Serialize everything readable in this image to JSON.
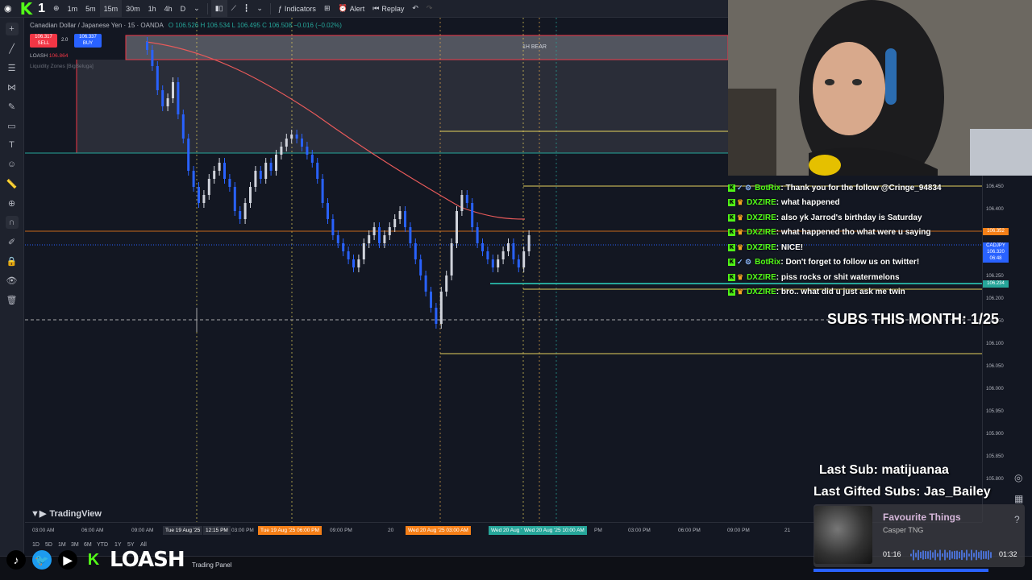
{
  "colors": {
    "up": "#d1d4dc",
    "down": "#2962ff",
    "ema": "#e85a5a",
    "level_yellow": "#e5d25d",
    "level_teal": "#26a69a",
    "bear_zone": "#f23645",
    "kick_green": "#53fc18"
  },
  "topbar": {
    "channel_number": "1",
    "timeframes": [
      "1m",
      "5m",
      "15m",
      "30m",
      "1h",
      "4h",
      "D"
    ],
    "active_timeframe": "15m",
    "indicators_label": "Indicators",
    "alert_label": "Alert",
    "replay_label": "Replay"
  },
  "legend": {
    "symbol": "Canadian Dollar / Japanese Yen · 15 · OANDA",
    "ohlc": "O 106.526  H 106.534  L 106.495  C 106.508  −0.016 (−0.02%)",
    "sell_price": "106.317",
    "sell_label": "SELL",
    "spread": "2.0",
    "buy_price": "106.337",
    "buy_label": "BUY",
    "indicator_1": "LOASH",
    "indicator_1_value": "106.864",
    "indicator_2": "Liquidity Zones [BigBeluga]"
  },
  "zone_label": "1H BEAR",
  "price_axis": {
    "labels": [
      "106.450",
      "106.400",
      "106.250",
      "106.200",
      "106.150",
      "106.100",
      "106.050",
      "106.000",
      "105.950",
      "105.900",
      "105.850",
      "105.800"
    ],
    "tag_level": "106.352",
    "tag_symbol": "CADJPY",
    "tag_price": "106.320",
    "tag_time": "06:48",
    "tag_green": "106.234"
  },
  "time_axis": {
    "labels": [
      "03:00 AM",
      "06:00 AM",
      "09:00 AM",
      "03:00 PM",
      "09:00 PM",
      "20",
      "PM",
      "03:00 PM",
      "06:00 PM",
      "09:00 PM",
      "21"
    ],
    "tag_1a": "Tue 19 Aug '25",
    "tag_1b": "12:15 PM",
    "tag_2": "Tue 19 Aug '25  06:00 PM",
    "tag_3": "Wed 20 Aug '25  03:00 AM",
    "tag_4": "Wed 20 Aug '25",
    "tag_5": "Wed 20 Aug '25  10:00 AM"
  },
  "tradingview_label": "TradingView",
  "bottom_tabs": [
    "1D",
    "5D",
    "1M",
    "3M",
    "6M",
    "YTD",
    "1Y",
    "5Y",
    "All"
  ],
  "trading_panel_label": "Trading Panel",
  "brand": {
    "name": "LOASH"
  },
  "chat": [
    {
      "user": "BotRix",
      "text": ": Thank you for the follow @Cringe_94834",
      "bot": true
    },
    {
      "user": "DXZIRE",
      "text": ": what happened",
      "bot": false
    },
    {
      "user": "DXZIRE",
      "text": ": also yk Jarrod's birthday is Saturday",
      "bot": false
    },
    {
      "user": "DXZIRE",
      "text": ": what happened tho what were u saying",
      "bot": false
    },
    {
      "user": "DXZIRE",
      "text": ": NICE!",
      "bot": false
    },
    {
      "user": "BotRix",
      "text": ": Don't forget to follow us on twitter!",
      "bot": true
    },
    {
      "user": "DXZIRE",
      "text": ": piss rocks or shit watermelons",
      "bot": false
    },
    {
      "user": "DXZIRE",
      "text": ": bro.. what did u just ask me twin",
      "bot": false
    }
  ],
  "subs_month": "SUBS THIS MONTH: 1/25",
  "last_sub": "Last Sub: matijuanaa",
  "last_gifted": "Last Gifted Subs: Jas_Bailey",
  "music": {
    "title": "Favourite Things",
    "artist": "Casper TNG",
    "current": "01:16",
    "total": "01:32",
    "progress": 0.83
  }
}
